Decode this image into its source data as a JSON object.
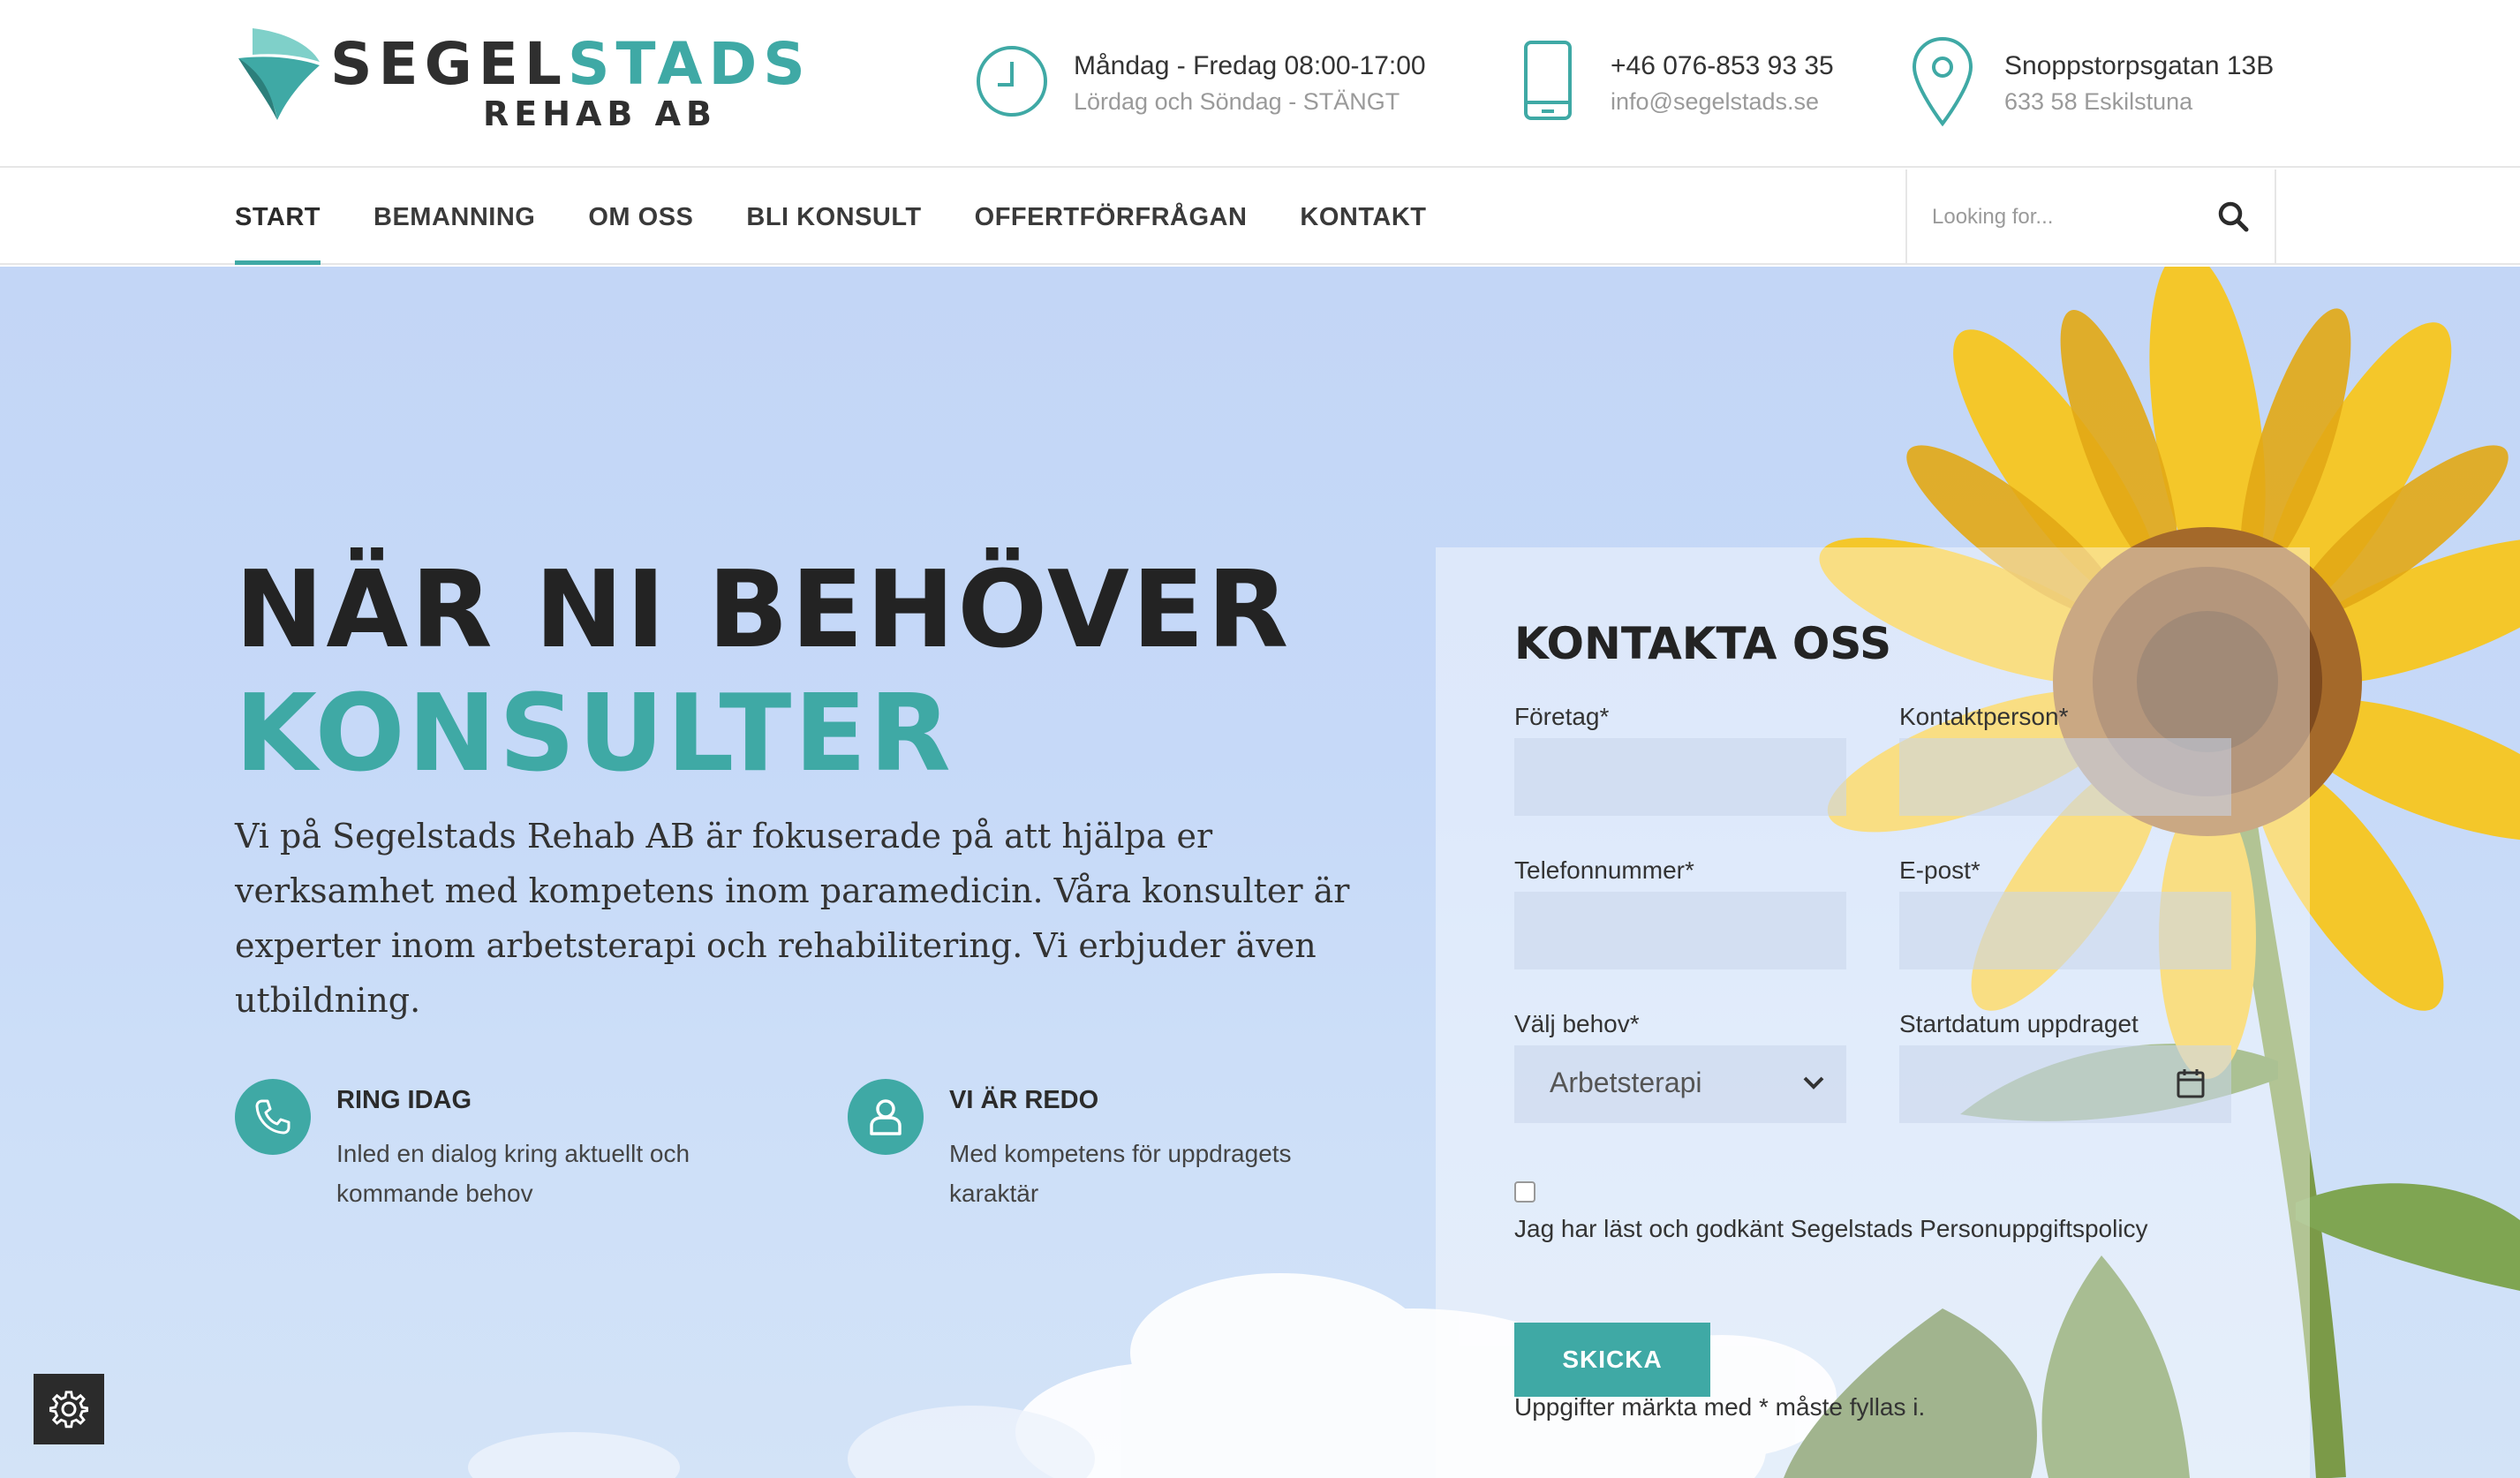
{
  "brand": {
    "name_part1": "SEGEL",
    "name_part2": "STADS",
    "name_line2": "REHAB AB",
    "colors": {
      "accent": "#3fa9a5",
      "dark": "#232323"
    }
  },
  "header": {
    "hours": {
      "icon": "clock-icon",
      "line1": "Måndag - Fredag 08:00-17:00",
      "line2": "Lördag och Söndag - STÄNGT"
    },
    "contact": {
      "icon": "phone-icon",
      "line1": "+46 076-853 93 35",
      "line2": "info@segelstads.se"
    },
    "address": {
      "icon": "map-pin-icon",
      "line1": "Snoppstorpsgatan 13B",
      "line2": "633 58 Eskilstuna"
    }
  },
  "nav": {
    "items": [
      {
        "label": "START",
        "active": true
      },
      {
        "label": "BEMANNING"
      },
      {
        "label": "OM OSS"
      },
      {
        "label": "BLI KONSULT"
      },
      {
        "label": "OFFERTFÖRFRÅGAN"
      },
      {
        "label": "KONTAKT"
      }
    ],
    "search": {
      "placeholder": "Looking for...",
      "icon": "search-icon"
    }
  },
  "hero": {
    "headline_line1": "NÄR NI BEHÖVER",
    "headline_line2": "KONSULTER",
    "intro": "Vi på Segelstads Rehab AB är fokuserade på att hjälpa er verksamhet med kompetens inom paramedicin. Våra konsulter är experter inom arbetsterapi och rehabilitering. Vi erbjuder även utbildning.",
    "features": [
      {
        "icon": "phone-icon",
        "title": "RING IDAG",
        "text": "Inled en dialog kring aktuellt och kommande behov"
      },
      {
        "icon": "user-icon",
        "title": "VI ÄR REDO",
        "text": "Med kompetens för uppdragets karaktär"
      }
    ]
  },
  "form": {
    "title": "KONTAKTA OSS",
    "company_label": "Företag*",
    "contact_person_label": "Kontaktperson*",
    "phone_label": "Telefonnummer*",
    "email_label": "E-post*",
    "need_label": "Välj behov*",
    "need_value": "Arbetsterapi",
    "start_date_label": "Startdatum uppdraget",
    "required_note": "Uppgifter märkta med * måste fyllas i.",
    "consent_text": "Jag har läst och godkänt Segelstads Personuppgiftspolicy",
    "submit_label": "SKICKA"
  },
  "settings": {
    "icon": "gear-icon"
  }
}
